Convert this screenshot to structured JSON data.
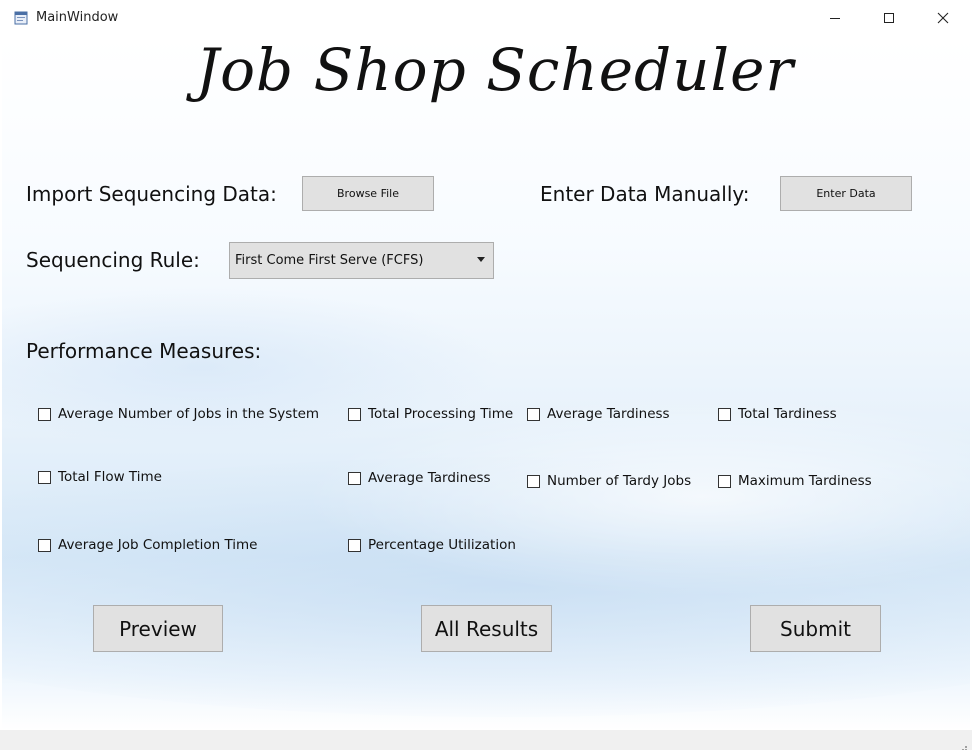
{
  "window": {
    "title": "MainWindow",
    "icon": "app-window-icon",
    "controls": [
      "minimize-icon",
      "maximize-icon",
      "close-icon"
    ]
  },
  "header": {
    "title": "Job Shop Scheduler"
  },
  "import": {
    "label": "Import Sequencing Data:",
    "button_label": "Browse File"
  },
  "manual": {
    "label": "Enter Data Manually:",
    "button_label": "Enter Data"
  },
  "sequencing": {
    "label": "Sequencing Rule:",
    "selected": "First Come First Serve (FCFS)"
  },
  "performance": {
    "heading": "Performance Measures:",
    "measures": [
      "Average Number of Jobs in the System",
      "Total Processing Time",
      "Average Tardiness",
      "Total Tardiness",
      "Total Flow Time",
      "Average Tardiness",
      "Number of Tardy Jobs",
      "Maximum Tardiness",
      "Average Job Completion Time",
      "Percentage Utilization"
    ]
  },
  "actions": {
    "preview_label": "Preview",
    "all_results_label": "All Results",
    "submit_label": "Submit"
  },
  "colors": {
    "button_bg": "#e1e1e1",
    "button_border": "#adadad",
    "background_accent": "#d6e8f7"
  }
}
